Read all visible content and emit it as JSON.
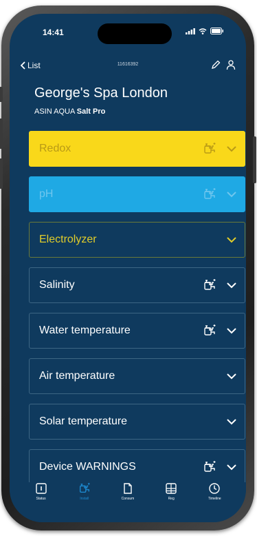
{
  "status_bar": {
    "time": "14:41"
  },
  "nav": {
    "back_label": "List",
    "device_id": "11616392",
    "edit_icon": "pencil-icon",
    "user_icon": "person-icon"
  },
  "header": {
    "title": "George's Spa London",
    "subtitle_prefix": "ASIN AQUA ",
    "subtitle_bold": "Salt Pro"
  },
  "cards": [
    {
      "label": "Redox",
      "pump": true,
      "style": "yellow"
    },
    {
      "label": "pH",
      "pump": true,
      "style": "cyan"
    },
    {
      "label": "Electrolyzer",
      "pump": false,
      "style": "olive"
    },
    {
      "label": "Salinity",
      "pump": true,
      "style": "dark"
    },
    {
      "label": "Water temperature",
      "pump": true,
      "style": "dark"
    },
    {
      "label": "Air temperature",
      "pump": false,
      "style": "dark"
    },
    {
      "label": "Solar temperature",
      "pump": false,
      "style": "dark"
    },
    {
      "label": "Device WARNINGS",
      "pump": true,
      "style": "dark"
    }
  ],
  "tabs": [
    {
      "label": "Status",
      "icon": "status-icon",
      "active": false
    },
    {
      "label": "Install",
      "icon": "pump-icon",
      "active": true
    },
    {
      "label": "Consum",
      "icon": "document-icon",
      "active": false
    },
    {
      "label": "Reg",
      "icon": "grid-icon",
      "active": false
    },
    {
      "label": "Timeline",
      "icon": "clock-icon",
      "active": false
    }
  ],
  "colors": {
    "background": "#0f3a5e",
    "redox": "#f9d81a",
    "ph": "#1fa9e4",
    "electrolyzer_text": "#e2cd2a",
    "active_tab": "#1e8ed6"
  }
}
